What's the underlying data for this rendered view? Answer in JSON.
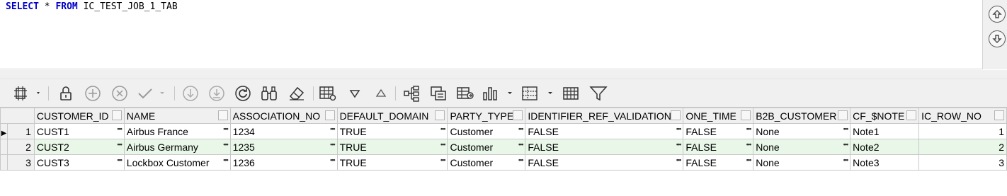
{
  "editor": {
    "kw_select": "SELECT",
    "star": " * ",
    "kw_from": "FROM",
    "table_name": " IC_TEST_JOB_1_TAB"
  },
  "side_buttons": [
    {
      "name": "scroll-up",
      "icon": "arrow-up-circle-icon"
    },
    {
      "name": "scroll-down",
      "icon": "arrow-down-circle-icon"
    }
  ],
  "grid": {
    "columns": [
      "CUSTOMER_ID",
      "NAME",
      "ASSOCIATION_NO",
      "DEFAULT_DOMAIN",
      "PARTY_TYPE",
      "IDENTIFIER_REF_VALIDATION",
      "ONE_TIME",
      "B2B_CUSTOMER",
      "CF_$NOTE",
      "IC_ROW_NO"
    ],
    "rows": [
      {
        "num": "1",
        "cells": [
          "CUST1",
          "Airbus France",
          "1234",
          "TRUE",
          "Customer",
          "FALSE",
          "FALSE",
          "None",
          "Note1",
          "1"
        ]
      },
      {
        "num": "2",
        "cells": [
          "CUST2",
          "Airbus Germany",
          "1235",
          "TRUE",
          "Customer",
          "FALSE",
          "FALSE",
          "None",
          "Note2",
          "2"
        ]
      },
      {
        "num": "3",
        "cells": [
          "CUST3",
          "Lockbox Customer",
          "1236",
          "TRUE",
          "Customer",
          "FALSE",
          "FALSE",
          "None",
          "Note3",
          "3"
        ]
      }
    ],
    "current_row": "1",
    "highlight_color": "#e8f7e8"
  },
  "colors": {
    "keyword": "#0000c8",
    "toolbar_bg": "#f0f0f0",
    "grid_border": "#c8c8c8"
  }
}
